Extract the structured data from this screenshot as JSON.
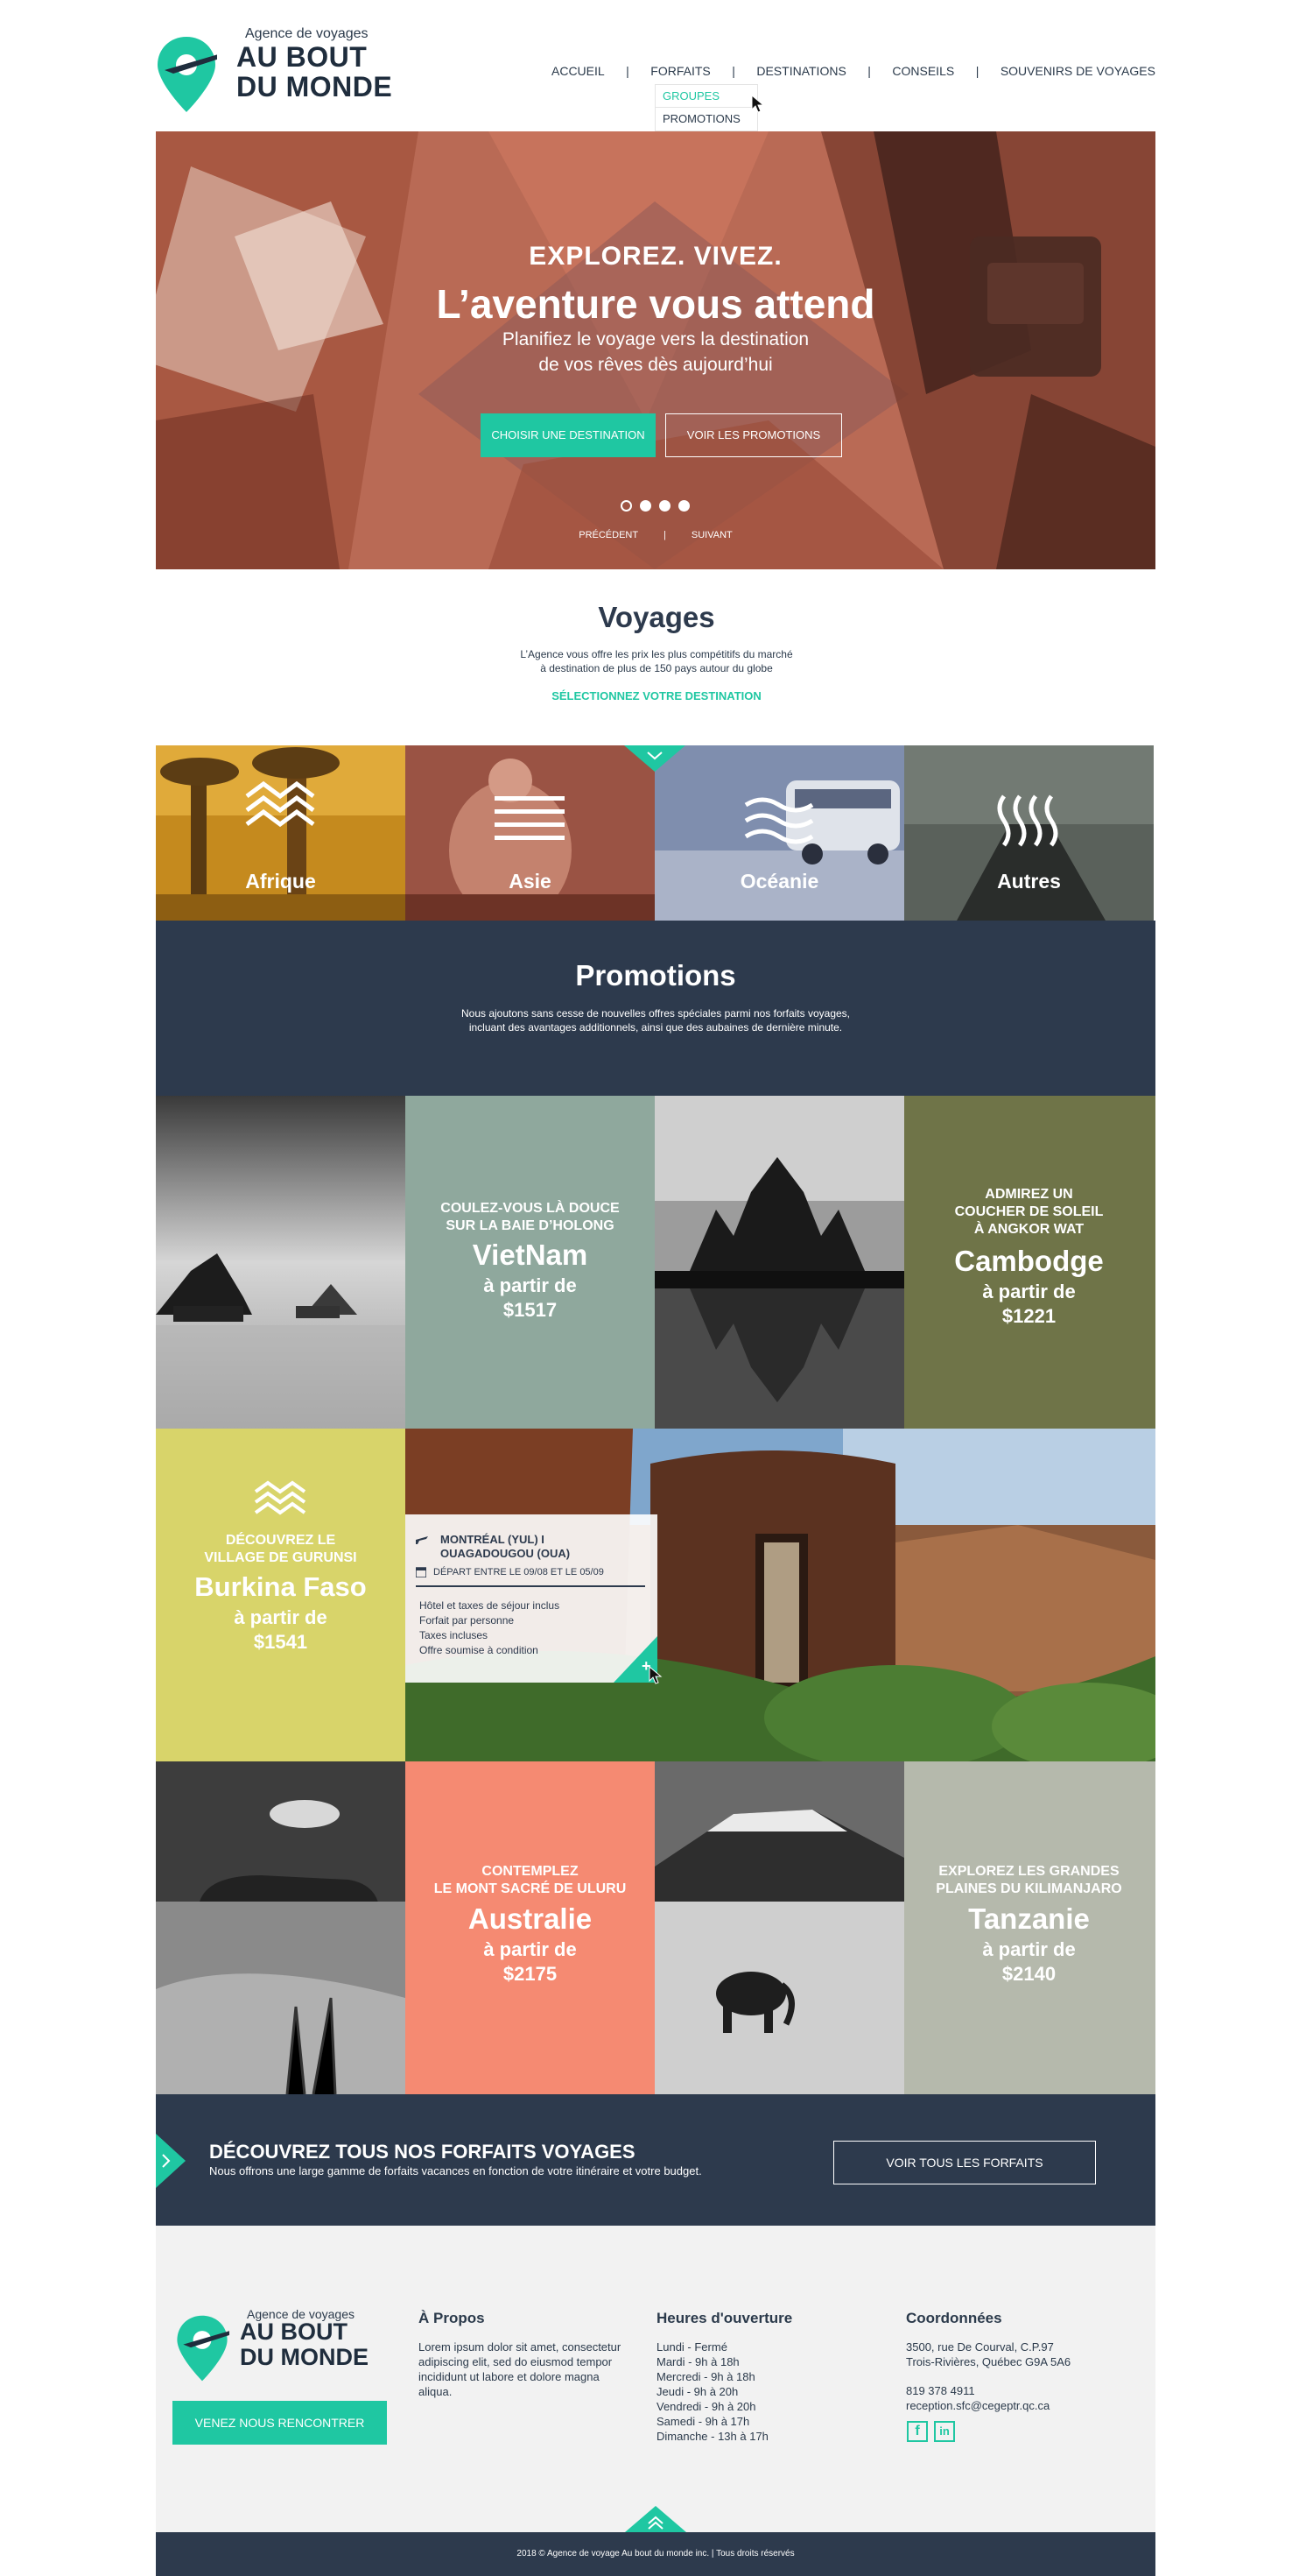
{
  "logo": {
    "small": "Agence de voyages",
    "line1": "AU BOUT",
    "line2": "DU MONDE"
  },
  "nav": {
    "items": [
      "ACCUEIL",
      "FORFAITS",
      "DESTINATIONS",
      "CONSEILS",
      "SOUVENIRS DE VOYAGES"
    ],
    "separator": "|"
  },
  "dropdown": {
    "items": [
      "GROUPES",
      "PROMOTIONS"
    ]
  },
  "hero": {
    "kicker": "EXPLOREZ. VIVEZ.",
    "title": "L’aventure vous attend",
    "subtitle1": "Planifiez le voyage vers la destination",
    "subtitle2": "de vos rêves dès aujourd’hui",
    "btn_primary": "CHOISIR UNE DESTINATION",
    "btn_secondary": "VOIR LES PROMOTIONS",
    "prev": "PRÉCÉDENT",
    "next": "SUIVANT",
    "separator": "|"
  },
  "voyages": {
    "title": "Voyages",
    "desc1": "L’Agence vous offre les prix les plus compétitifs du marché",
    "desc2": "à destination de plus de 150 pays autour du globe",
    "link": "SÉLECTIONNEZ VOTRE DESTINATION"
  },
  "destinations": [
    {
      "label": "Afrique",
      "icon": "zigzag-icon"
    },
    {
      "label": "Asie",
      "icon": "lines-icon"
    },
    {
      "label": "Océanie",
      "icon": "waves-icon"
    },
    {
      "label": "Autres",
      "icon": "vertical-waves-icon"
    }
  ],
  "promotions": {
    "title": "Promotions",
    "desc1": "Nous ajoutons sans cesse de nouvelles offres spéciales parmi nos forfaits voyages,",
    "desc2": "incluant des avantages additionnels, ainsi que des aubaines de dernière minute."
  },
  "promos": {
    "vietnam": {
      "kicker1": "COULEZ-VOUS LÀ DOUCE",
      "kicker2": "SUR LA BAIE D’HOLONG",
      "country": "VietNam",
      "from": "à partir de",
      "price": "$1517"
    },
    "cambodge": {
      "kicker1": "ADMIREZ UN",
      "kicker2": "COUCHER DE SOLEIL",
      "kicker3": "À ANGKOR WAT",
      "country": "Cambodge",
      "from": "à partir de",
      "price": "$1221"
    },
    "burkina": {
      "kicker1": "DÉCOUVREZ LE",
      "kicker2": "VILLAGE DE GURUNSI",
      "country": "Burkina Faso",
      "from": "à partir de",
      "price": "$1541"
    },
    "australie": {
      "kicker1": "CONTEMPLEZ",
      "kicker2": "LE MONT SACRÉ DE ULURU",
      "country": "Australie",
      "from": "à partir de",
      "price": "$2175"
    },
    "tanzanie": {
      "kicker1": "EXPLOREZ LES GRANDES",
      "kicker2": "PLAINES DU KILIMANJARO",
      "country": "Tanzanie",
      "from": "à partir de",
      "price": "$2140"
    }
  },
  "detail_card": {
    "route1": "MONTRÉAL (YUL) I",
    "route2": "OUAGADOUGOU (OUA)",
    "dates": "DÉPART ENTRE LE 09/08 ET LE 05/09",
    "lines": [
      "Hôtel et taxes de séjour inclus",
      "Forfait par personne",
      "Taxes incluses",
      "Offre soumise à condition"
    ],
    "plus": "+"
  },
  "cta": {
    "title": "DÉCOUVREZ TOUS NOS FORFAITS VOYAGES",
    "desc": "Nous offrons une large gamme de forfaits vacances en fonction de votre itinéraire et votre budget.",
    "button": "VOIR TOUS LES FORFAITS"
  },
  "footer": {
    "meet_button": "VENEZ NOUS RENCONTRER",
    "about": {
      "title": "À Propos",
      "text": [
        "Lorem ipsum dolor sit amet, consectetur",
        "adipiscing elit, sed do eiusmod tempor",
        "incididunt ut labore et dolore magna",
        "aliqua."
      ]
    },
    "hours": {
      "title": "Heures d'ouverture",
      "lines": [
        "Lundi - Fermé",
        "Mardi - 9h à 18h",
        "Mercredi - 9h à 18h",
        "Jeudi - 9h à 20h",
        "Vendredi - 9h à 20h",
        "Samedi - 9h à 17h",
        "Dimanche - 13h à 17h"
      ]
    },
    "contact": {
      "title": "Coordonnées",
      "address1": "3500, rue De Courval, C.P.97",
      "address2": "Trois-Rivières, Québec G9A 5A6",
      "phone": "819 378 4911",
      "email": "reception.sfc@cegeptr.qc.ca"
    },
    "social": [
      "f",
      "in"
    ],
    "copyright": "2018 © Agence de voyage Au bout du monde inc. | Tous droits réservés"
  },
  "colors": {
    "teal": "#1fc7a2",
    "navy": "#2d3a4d",
    "salmon": "#f58a72",
    "sage": "#8fa89d",
    "olive": "#6f7448",
    "yellow": "#d8d46a",
    "grey": "#b5b9ac"
  }
}
